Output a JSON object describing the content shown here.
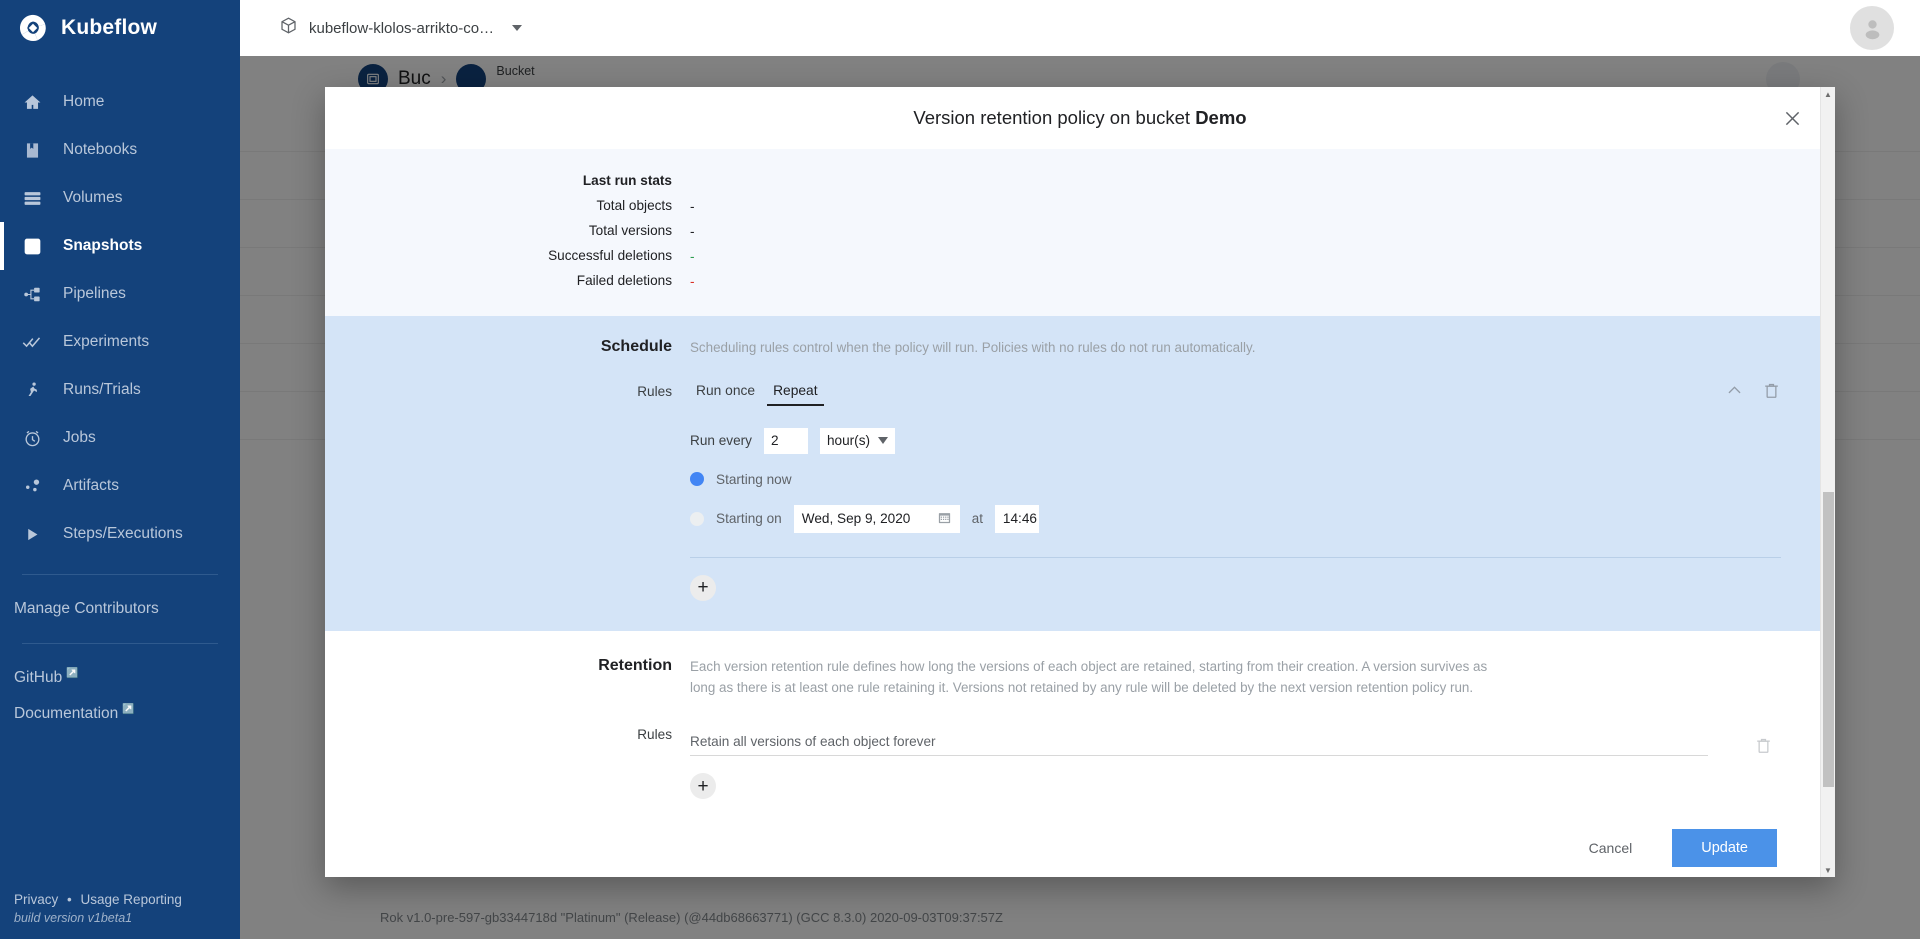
{
  "sidebar": {
    "brand": "Kubeflow",
    "items": [
      {
        "label": "Home",
        "icon": "home-icon",
        "active": false
      },
      {
        "label": "Notebooks",
        "icon": "notebook-icon",
        "active": false
      },
      {
        "label": "Volumes",
        "icon": "volumes-icon",
        "active": false
      },
      {
        "label": "Snapshots",
        "icon": "snapshots-icon",
        "active": true
      },
      {
        "label": "Pipelines",
        "icon": "pipelines-icon",
        "active": false
      },
      {
        "label": "Experiments",
        "icon": "experiments-icon",
        "active": false
      },
      {
        "label": "Runs/Trials",
        "icon": "runs-trials-icon",
        "active": false
      },
      {
        "label": "Jobs",
        "icon": "jobs-clock-icon",
        "active": false
      },
      {
        "label": "Artifacts",
        "icon": "artifacts-icon",
        "active": false
      },
      {
        "label": "Steps/Executions",
        "icon": "steps-executions-play-icon",
        "active": false
      }
    ],
    "manage_contributors": "Manage Contributors",
    "github": "GitHub",
    "documentation": "Documentation",
    "footer": {
      "privacy": "Privacy",
      "separator": "•",
      "usage_reporting": "Usage Reporting",
      "build_version": "build version v1beta1"
    }
  },
  "topbar": {
    "namespace": "kubeflow-klolos-arrikto-co…",
    "namespace_icon": "package-cube-icon",
    "avatar_icon": "user-avatar-icon"
  },
  "background_page": {
    "breadcrumb_trailing_label": "Bucket",
    "version_string": "Rok v1.0-pre-597-gb3344718d \"Platinum\" (Release) (@44db68663771) (GCC 8.3.0) 2020-09-03T09:37:57Z"
  },
  "modal": {
    "title_prefix": "Version retention policy on bucket ",
    "title_bucket": "Demo",
    "close_icon": "close-x-icon",
    "stats": {
      "heading": "Last run stats",
      "rows": [
        {
          "label": "Total objects",
          "value": "-",
          "tone": "neutral"
        },
        {
          "label": "Total versions",
          "value": "-",
          "tone": "neutral"
        },
        {
          "label": "Successful deletions",
          "value": "-",
          "tone": "ok"
        },
        {
          "label": "Failed deletions",
          "value": "-",
          "tone": "bad"
        }
      ]
    },
    "schedule": {
      "title": "Schedule",
      "description": "Scheduling rules control when the policy will run. Policies with no rules do not run automatically.",
      "rules_label": "Rules",
      "tabs": [
        {
          "label": "Run once",
          "active": false
        },
        {
          "label": "Repeat",
          "active": true
        }
      ],
      "collapse_icon": "chevron-up-icon",
      "delete_icon": "trash-icon",
      "run_every_label": "Run every",
      "run_every_value": "2",
      "run_every_unit": "hour(s)",
      "unit_caret_icon": "triangle-down-icon",
      "starting_now_label": "Starting now",
      "starting_now_selected": true,
      "starting_on_label": "Starting on",
      "starting_on_selected": false,
      "starting_on_date": "Wed, Sep 9, 2020",
      "calendar_icon": "calendar-icon",
      "at_label": "at",
      "starting_on_time": "14:46",
      "add_rule_label": "+"
    },
    "retention": {
      "title": "Retention",
      "description": "Each version retention rule defines how long the versions of each object are retained, starting from their creation. A version survives as long as there is at least one rule retaining it. Versions not retained by any rule will be deleted by the next version retention policy run.",
      "rules_label": "Rules",
      "rule_text": "Retain all versions of each object forever",
      "delete_icon": "trash-icon",
      "add_rule_label": "+"
    },
    "actions": {
      "cancel": "Cancel",
      "update": "Update"
    },
    "scrollbar": {
      "up_arrow_icon": "scroll-up-arrow-icon",
      "down_arrow_icon": "scroll-down-arrow-icon"
    }
  },
  "colors": {
    "sidebar_bg": "#14427b",
    "accent_blue": "#4285f4",
    "primary_button": "#4b92e8",
    "schedule_band": "#d4e4f7",
    "stats_band": "#f5f8fd",
    "success": "#2e9e4f",
    "danger": "#d93025"
  }
}
